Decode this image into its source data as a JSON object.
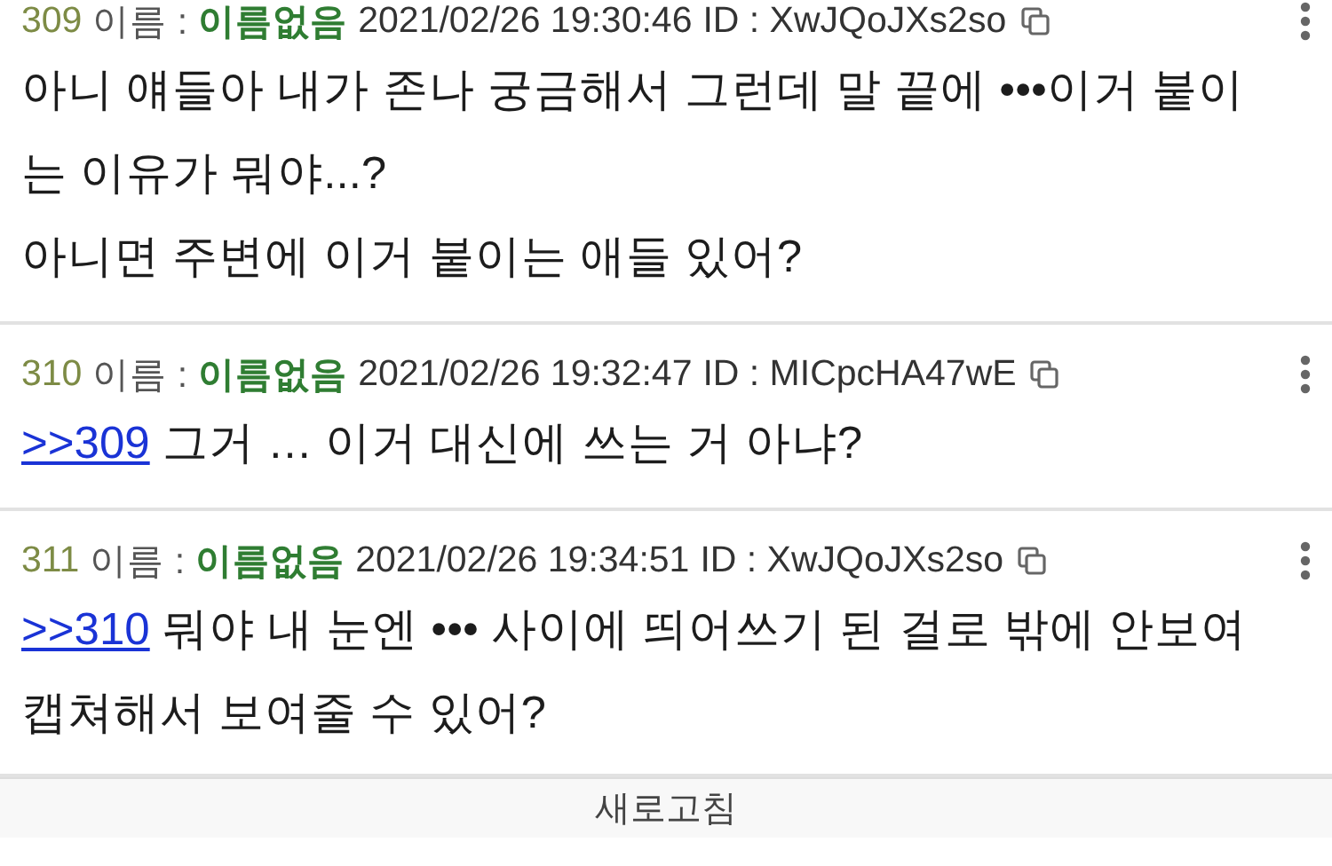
{
  "posts": [
    {
      "number": "309",
      "name_label": "이름 :",
      "name": "이름없음",
      "date": "2021/02/26 19:30:46",
      "id": "ID : XwJQoJXs2so",
      "paragraphs": [
        [
          {
            "kind": "text",
            "text": "아니 얘들아 내가 존나 궁금해서 그런데 말 끝에 •••이거 붙이는 이유가 뭐야...?"
          }
        ],
        [
          {
            "kind": "text",
            "text": "아니면 주변에 이거 붙이는 애들 있어?"
          }
        ]
      ]
    },
    {
      "number": "310",
      "name_label": "이름 :",
      "name": "이름없음",
      "date": "2021/02/26 19:32:47",
      "id": "ID : MICpcHA47wE",
      "paragraphs": [
        [
          {
            "kind": "link",
            "text": ">>309"
          },
          {
            "kind": "text",
            "text": " 그거 … 이거 대신에 쓰는 거 아냐?"
          }
        ]
      ]
    },
    {
      "number": "311",
      "name_label": "이름 :",
      "name": "이름없음",
      "date": "2021/02/26 19:34:51",
      "id": "ID : XwJQoJXs2so",
      "paragraphs": [
        [
          {
            "kind": "link",
            "text": ">>310"
          },
          {
            "kind": "text",
            "text": " 뭐야 내 눈엔 ••• 사이에 띄어쓰기 된 걸로 밖에 안보여 캡쳐해서 보여줄 수 있어?"
          }
        ]
      ]
    }
  ],
  "refresh_button": "새로고침"
}
